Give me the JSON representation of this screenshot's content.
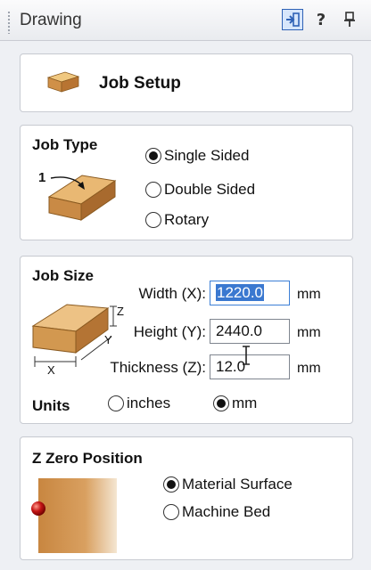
{
  "header": {
    "title": "Drawing",
    "help_label": "?",
    "pin_label": "⬆"
  },
  "job_setup": {
    "label": "Job Setup"
  },
  "job_type": {
    "title": "Job Type",
    "diagram_label": "1",
    "options": [
      {
        "label": "Single Sided",
        "selected": true
      },
      {
        "label": "Double Sided",
        "selected": false
      },
      {
        "label": "Rotary",
        "selected": false
      }
    ]
  },
  "job_size": {
    "title": "Job Size",
    "diagram": {
      "z": "Z",
      "y": "Y",
      "x": "X"
    },
    "fields": [
      {
        "label": "Width (X):",
        "value": "1220.0",
        "unit": "mm"
      },
      {
        "label": "Height (Y):",
        "value": "2440.0",
        "unit": "mm"
      },
      {
        "label": "Thickness (Z):",
        "value": "12.0",
        "unit": "mm"
      }
    ],
    "units": {
      "label": "Units",
      "options": [
        {
          "label": "inches",
          "selected": false
        },
        {
          "label": "mm",
          "selected": true
        }
      ]
    }
  },
  "z_zero": {
    "title": "Z Zero Position",
    "options": [
      {
        "label": "Material Surface",
        "selected": true
      },
      {
        "label": "Machine Bed",
        "selected": false
      }
    ]
  }
}
